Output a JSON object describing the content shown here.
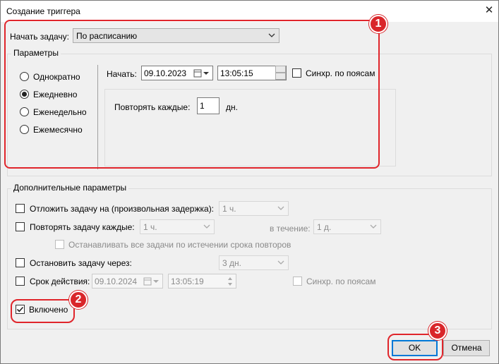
{
  "window": {
    "title": "Создание триггера",
    "close_symbol": "✕"
  },
  "start_task": {
    "label": "Начать задачу:",
    "value": "По расписанию"
  },
  "parameters": {
    "legend": "Параметры",
    "radios": [
      {
        "label": "Однократно",
        "checked": false
      },
      {
        "label": "Ежедневно",
        "checked": true
      },
      {
        "label": "Еженедельно",
        "checked": false
      },
      {
        "label": "Ежемесячно",
        "checked": false
      }
    ],
    "start_label": "Начать:",
    "start_date": "09.10.2023",
    "start_time": "13:05:15",
    "sync_label": "Синхр. по поясам",
    "repeat_every_label": "Повторять каждые:",
    "repeat_every_value": "1",
    "repeat_unit": "дн."
  },
  "advanced": {
    "legend": "Дополнительные параметры",
    "delay_label": "Отложить задачу на (произвольная задержка):",
    "delay_value": "1 ч.",
    "repeat_label": "Повторять задачу каждые:",
    "repeat_value": "1 ч.",
    "duration_label": "в течение:",
    "duration_value": "1 д.",
    "stop_all_label": "Останавливать все задачи по истечении срока повторов",
    "stop_after_label": "Остановить задачу через:",
    "stop_after_value": "3 дн.",
    "expire_label": "Срок действия:",
    "expire_date": "09.10.2024",
    "expire_time": "13:05:19",
    "expire_sync_label": "Синхр. по поясам",
    "enabled_label": "Включено",
    "enabled_checked": true
  },
  "buttons": {
    "ok": "OK",
    "cancel": "Отмена"
  },
  "markers": [
    "1",
    "2",
    "3"
  ],
  "colors": {
    "accent": "#0078d7",
    "highlight": "#e0252b"
  }
}
